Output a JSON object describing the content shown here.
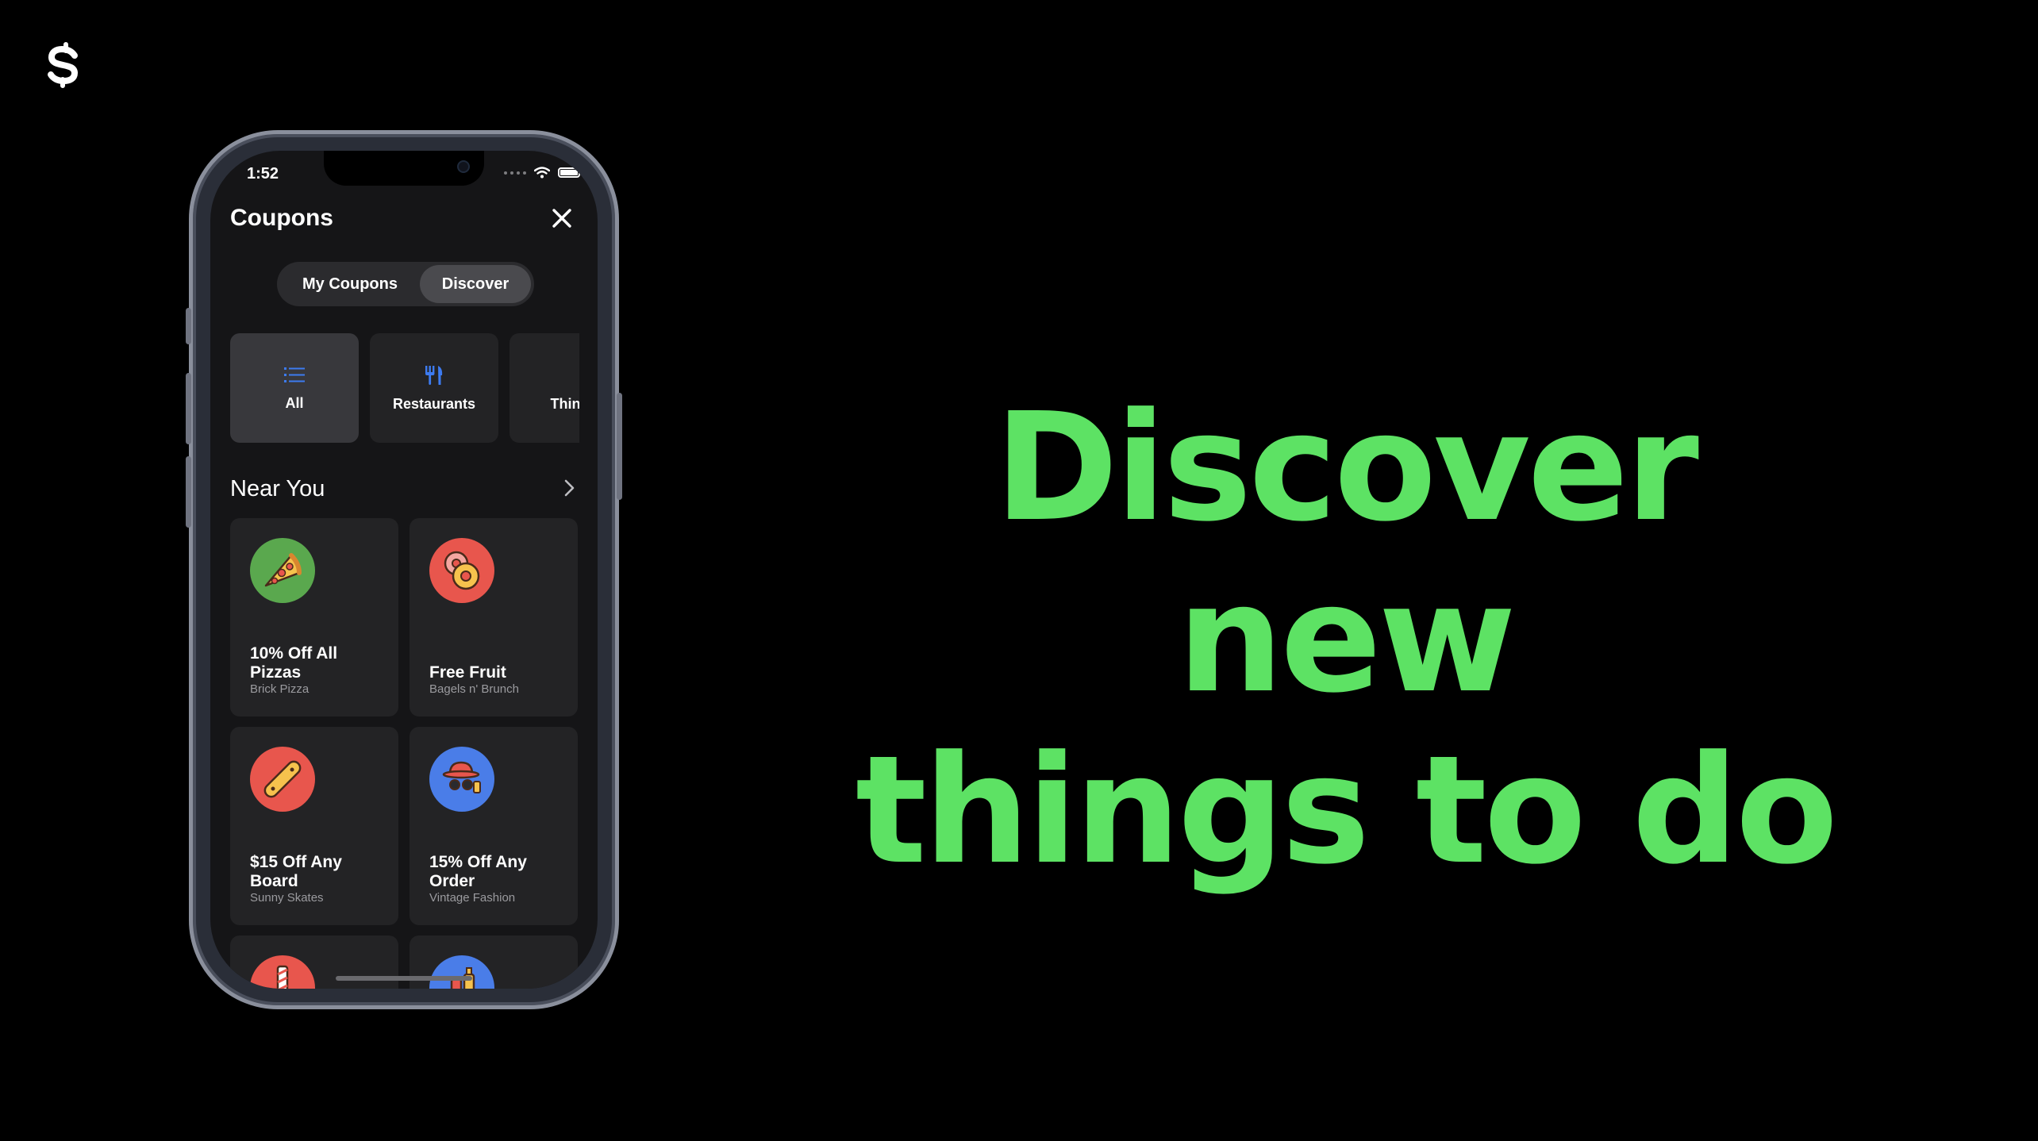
{
  "hero": {
    "line1": "Discover new",
    "line2": "things to do"
  },
  "status": {
    "time": "1:52"
  },
  "header": {
    "title": "Coupons"
  },
  "tabs": [
    {
      "label": "My Coupons",
      "active": false
    },
    {
      "label": "Discover",
      "active": true
    }
  ],
  "categories": [
    {
      "label": "All",
      "icon": "list-icon",
      "active": true
    },
    {
      "label": "Restaurants",
      "icon": "fork-knife-icon",
      "active": false
    },
    {
      "label": "Things",
      "icon": "ticket-icon",
      "active": false
    }
  ],
  "section": {
    "title": "Near You"
  },
  "coupons": [
    {
      "title": "10% Off All Pizzas",
      "merchant": "Brick Pizza",
      "icon": "pizza-icon",
      "color": "#5aa84e"
    },
    {
      "title": "Free Fruit",
      "merchant": "Bagels n' Brunch",
      "icon": "donut-icon",
      "color": "#e8564d"
    },
    {
      "title": "$15 Off Any Board",
      "merchant": "Sunny Skates",
      "icon": "skateboard-icon",
      "color": "#e8564d"
    },
    {
      "title": "15% Off Any Order",
      "merchant": "Vintage Fashion",
      "icon": "hat-glasses-icon",
      "color": "#4a7de8"
    },
    {
      "title": "",
      "merchant": "",
      "icon": "barber-pole-icon",
      "color": "#e8564d"
    },
    {
      "title": "",
      "merchant": "",
      "icon": "bottles-icon",
      "color": "#4a7de8"
    }
  ],
  "colors": {
    "accent": "#5de264",
    "icon_blue": "#3d7bf0"
  }
}
